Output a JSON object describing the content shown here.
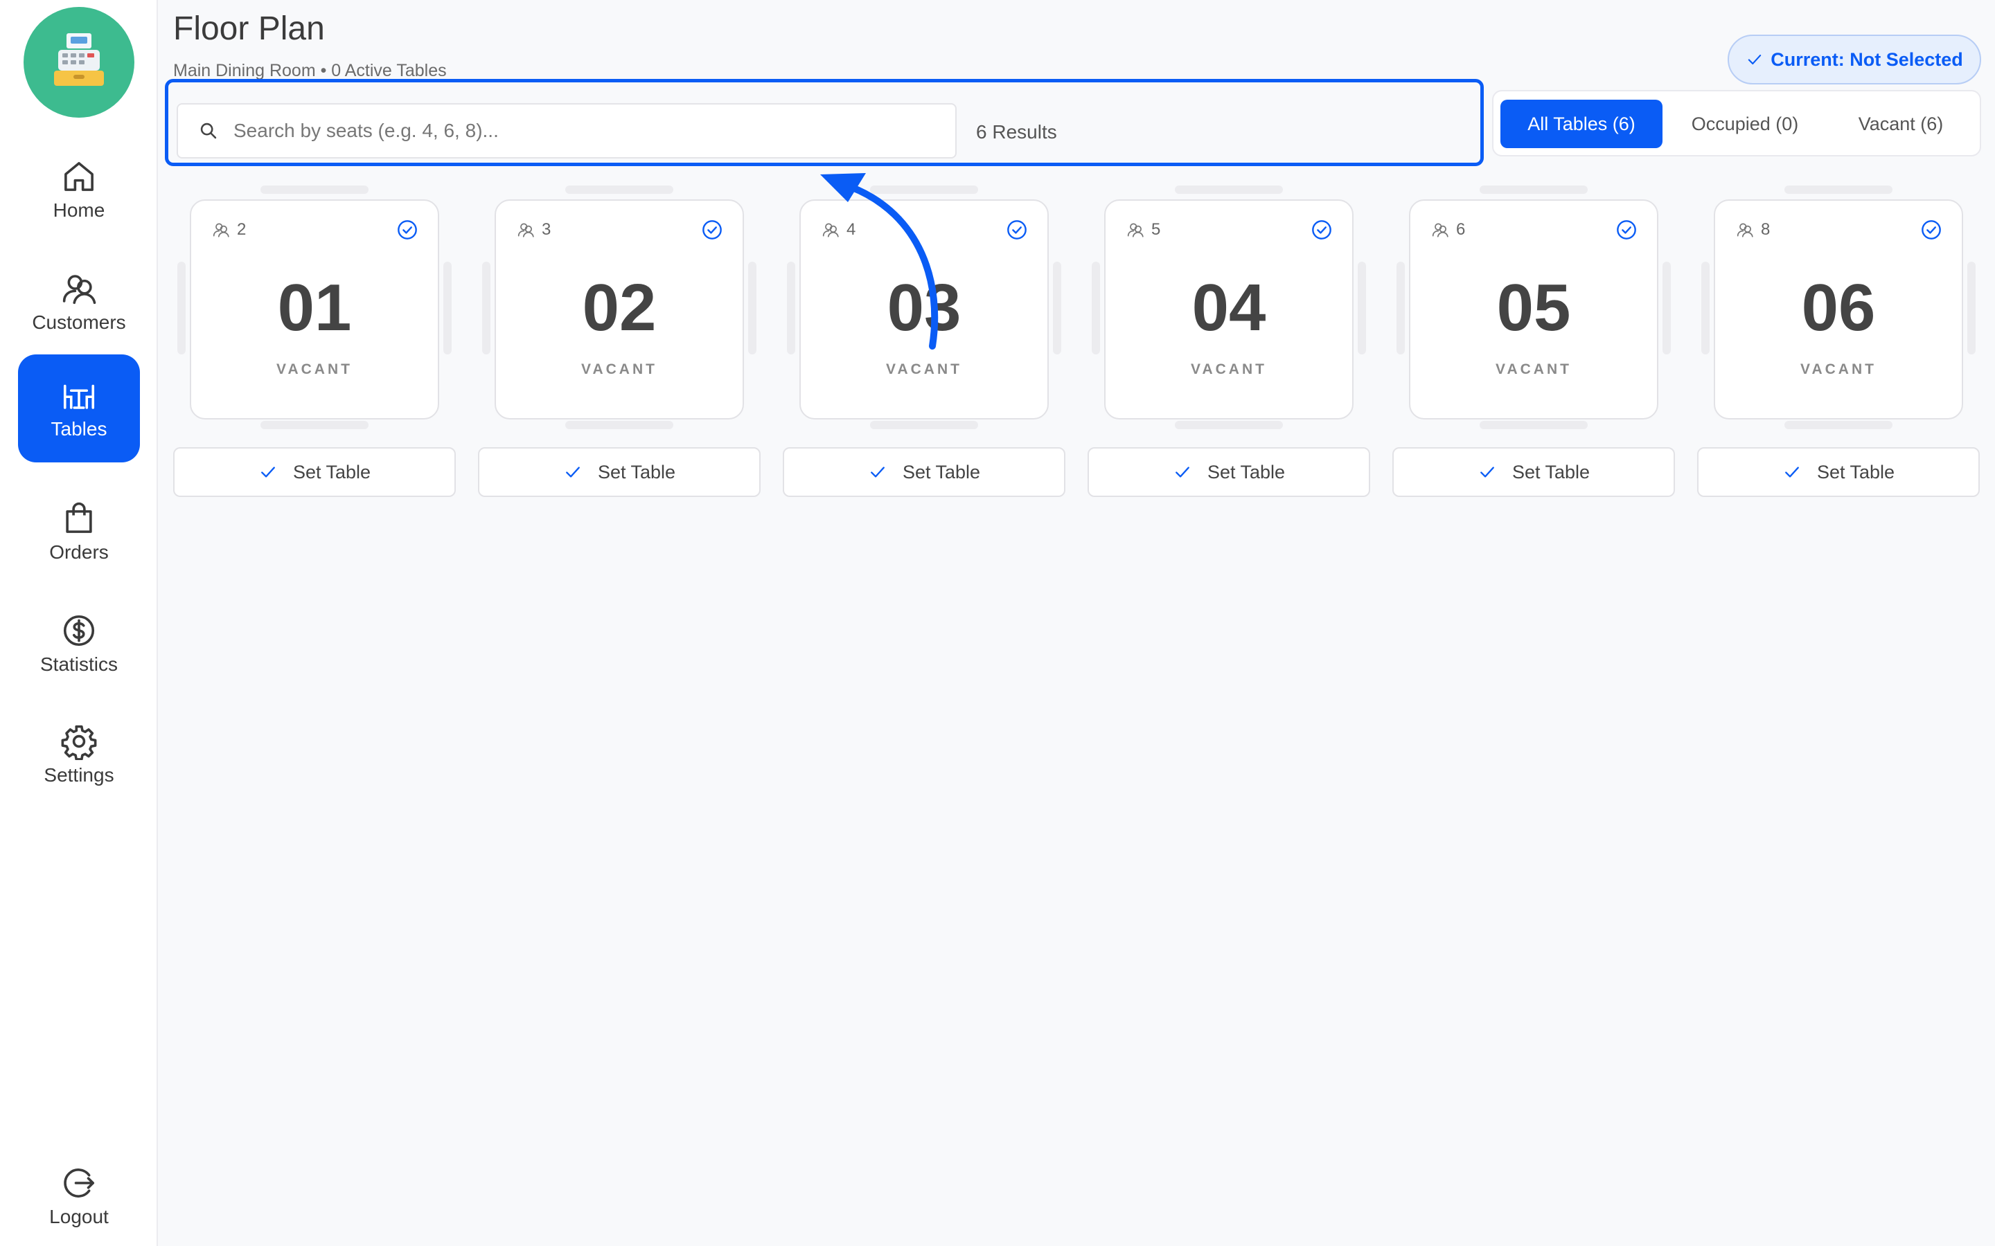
{
  "sidebar": {
    "logo_icon": "cash-register-icon",
    "items": [
      {
        "label": "Home",
        "icon": "home-icon",
        "active": false
      },
      {
        "label": "Customers",
        "icon": "users-icon",
        "active": false
      },
      {
        "label": "Tables",
        "icon": "table-icon",
        "active": true
      },
      {
        "label": "Orders",
        "icon": "shopping-bag-icon",
        "active": false
      },
      {
        "label": "Statistics",
        "icon": "dollar-circle-icon",
        "active": false
      },
      {
        "label": "Settings",
        "icon": "gear-icon",
        "active": false
      }
    ],
    "logout_label": "Logout"
  },
  "header": {
    "title": "Floor Plan",
    "subtitle": "Main Dining Room • 0 Active Tables",
    "current_label": "Current: Not Selected"
  },
  "search": {
    "placeholder": "Search by seats (e.g. 4, 6, 8)...",
    "value": "",
    "results": "6 Results"
  },
  "filters": [
    {
      "label": "All Tables (6)",
      "active": true
    },
    {
      "label": "Occupied (0)",
      "active": false
    },
    {
      "label": "Vacant (6)",
      "active": false
    }
  ],
  "tables": [
    {
      "number": "01",
      "seats": "2",
      "status": "VACANT",
      "action": "Set Table"
    },
    {
      "number": "02",
      "seats": "3",
      "status": "VACANT",
      "action": "Set Table"
    },
    {
      "number": "03",
      "seats": "4",
      "status": "VACANT",
      "action": "Set Table"
    },
    {
      "number": "04",
      "seats": "5",
      "status": "VACANT",
      "action": "Set Table"
    },
    {
      "number": "05",
      "seats": "6",
      "status": "VACANT",
      "action": "Set Table"
    },
    {
      "number": "06",
      "seats": "8",
      "status": "VACANT",
      "action": "Set Table"
    }
  ],
  "colors": {
    "accent": "#0a5cf5",
    "logo_bg": "#3dbb8f",
    "background": "#f8f9fb"
  }
}
